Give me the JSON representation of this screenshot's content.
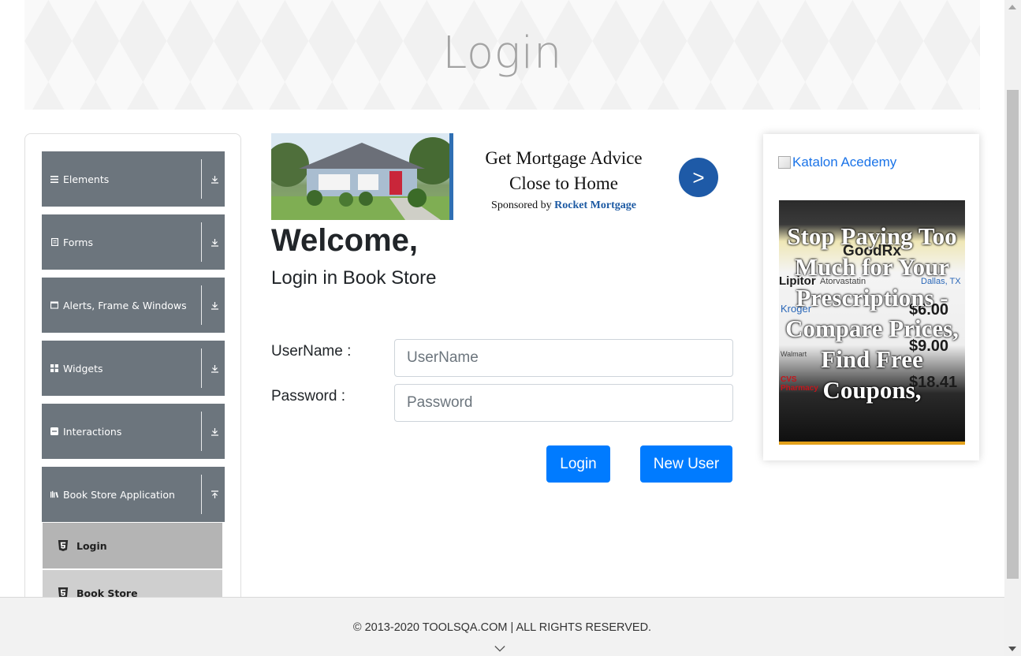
{
  "header": {
    "title": "Login"
  },
  "sidebar": {
    "groups": [
      {
        "label": "Elements",
        "icon": "menu-icon",
        "toggle": "expand-down-icon"
      },
      {
        "label": "Forms",
        "icon": "form-icon",
        "toggle": "expand-down-icon"
      },
      {
        "label": "Alerts, Frame & Windows",
        "icon": "window-icon",
        "toggle": "expand-down-icon"
      },
      {
        "label": "Widgets",
        "icon": "widgets-icon",
        "toggle": "expand-down-icon"
      },
      {
        "label": "Interactions",
        "icon": "interactions-icon",
        "toggle": "expand-down-icon"
      },
      {
        "label": "Book Store Application",
        "icon": "book-icon",
        "toggle": "collapse-up-icon"
      }
    ],
    "sub_items": [
      {
        "label": "Login",
        "icon": "html5-icon",
        "active": true
      },
      {
        "label": "Book Store",
        "icon": "html5-icon",
        "active": false
      }
    ]
  },
  "ad_top": {
    "line1": "Get Mortgage Advice",
    "line2": "Close to Home",
    "sponsored_prefix": "Sponsored by",
    "sponsor": "Rocket Mortgage",
    "go_label": ">"
  },
  "main": {
    "welcome": "Welcome,",
    "subtitle": "Login in Book Store",
    "username_label": "UserName :",
    "username_placeholder": "UserName",
    "username_value": "",
    "password_label": "Password :",
    "password_placeholder": "Password",
    "password_value": "",
    "login_button": "Login",
    "new_user_button": "New User"
  },
  "right_ad": {
    "link_text": "Katalon Acedemy",
    "rx_lines": [
      "GoodRx",
      "Lipitor",
      "Atorvastatin",
      "Dallas, TX",
      "Kroger",
      "$6.00",
      "Walmart",
      "$9.00",
      "CVS Pharmacy",
      "$18.41"
    ],
    "headline": "Stop Paying Too Much for Your Prescriptions - Compare Prices, Find Free Coupons,"
  },
  "footer": {
    "copyright": "© 2013-2020 TOOLSQA.COM | ALL RIGHTS RESERVED."
  },
  "colors": {
    "sidebar_group": "#6c757d",
    "primary_button": "#007bff",
    "active_sub_item": "#b4b4b4",
    "inactive_sub_item": "#cfcfcf",
    "sponsor_link": "#1d5aa3",
    "ad_button": "#1e5aa7"
  }
}
